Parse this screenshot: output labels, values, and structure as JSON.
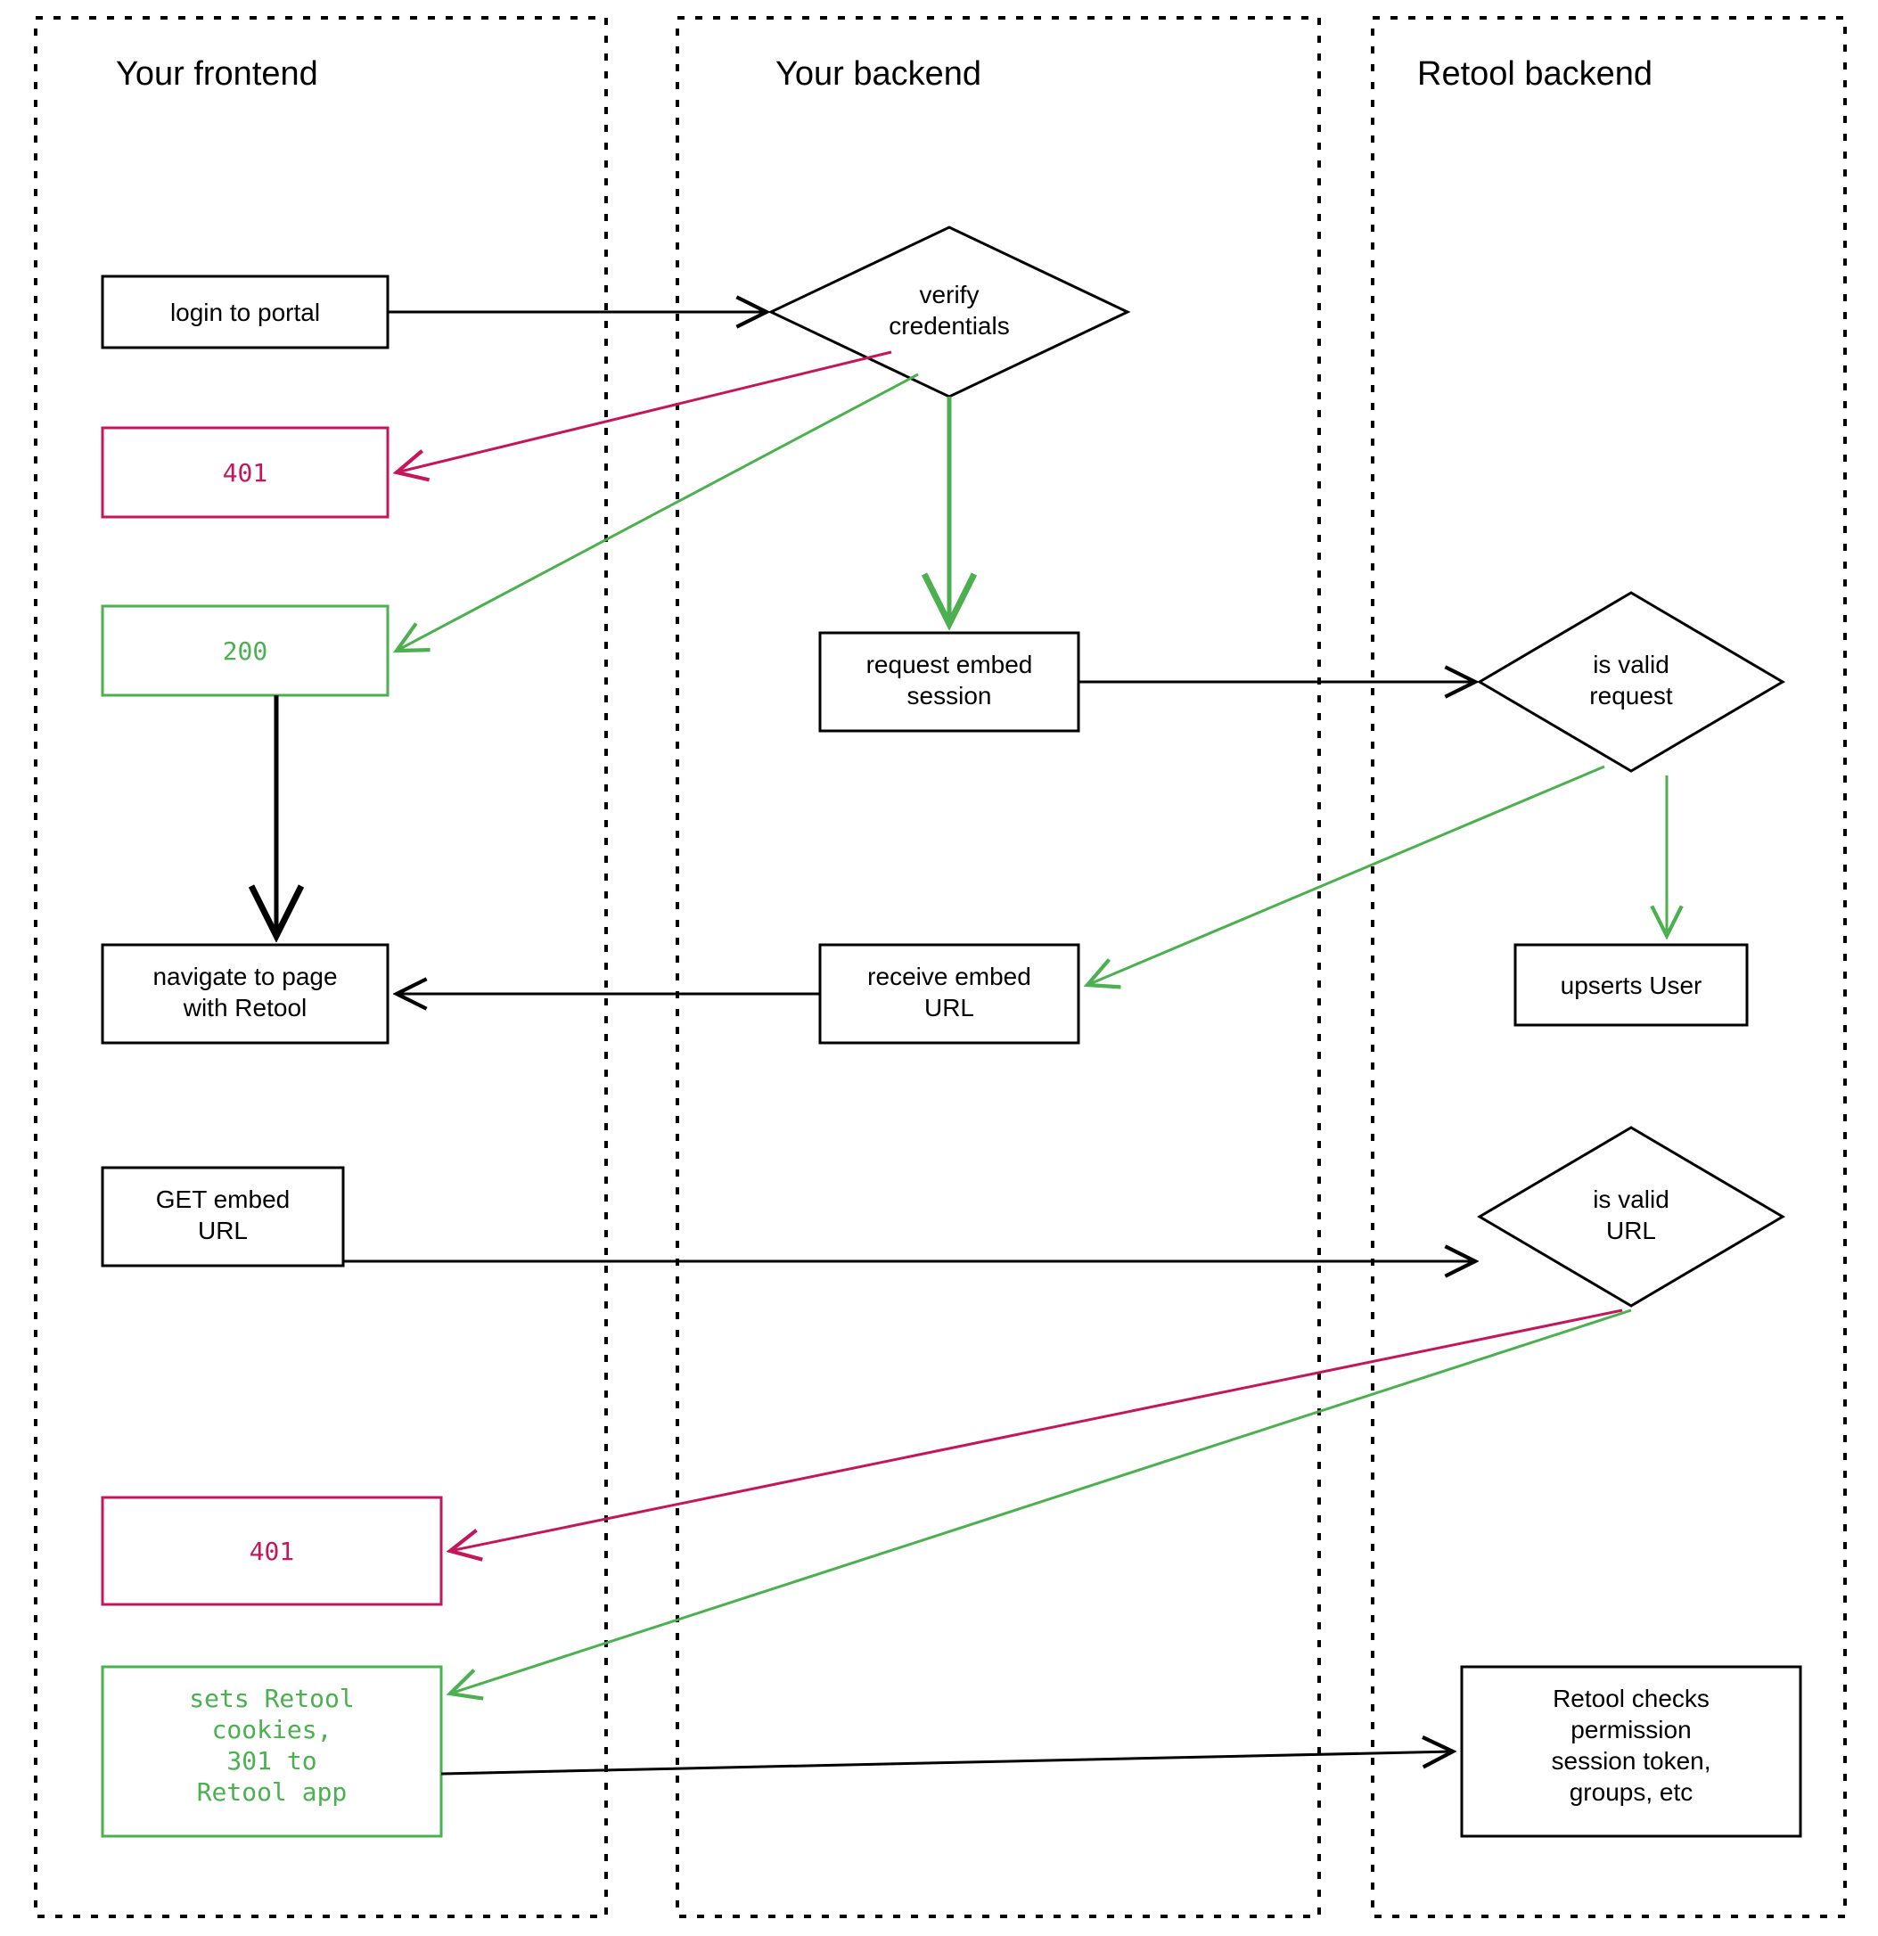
{
  "colors": {
    "black": "#000000",
    "red": "#c2185b",
    "green": "#4caf50"
  },
  "swimlanes": {
    "frontend": "Your frontend",
    "backend": "Your backend",
    "retool": "Retool backend"
  },
  "nodes": {
    "login": "login to portal",
    "verify1": "verify",
    "verify2": "credentials",
    "err401a": "401",
    "ok200": "200",
    "reqEmbed1": "request embed",
    "reqEmbed2": "session",
    "isValidReq1": "is valid",
    "isValidReq2": "request",
    "navigate1": "navigate to page",
    "navigate2": "with Retool",
    "recvURL1": "receive embed",
    "recvURL2": "URL",
    "upserts": "upserts User",
    "getURL1": "GET embed",
    "getURL2": "URL",
    "isValidURL1": "is valid",
    "isValidURL2": "URL",
    "err401b": "401",
    "setsCookies1": "sets Retool",
    "setsCookies2": "cookies,",
    "setsCookies3": "301 to",
    "setsCookies4": "Retool app",
    "retoolChecks1": "Retool checks",
    "retoolChecks2": "permission",
    "retoolChecks3": "session token,",
    "retoolChecks4": "groups, etc"
  }
}
